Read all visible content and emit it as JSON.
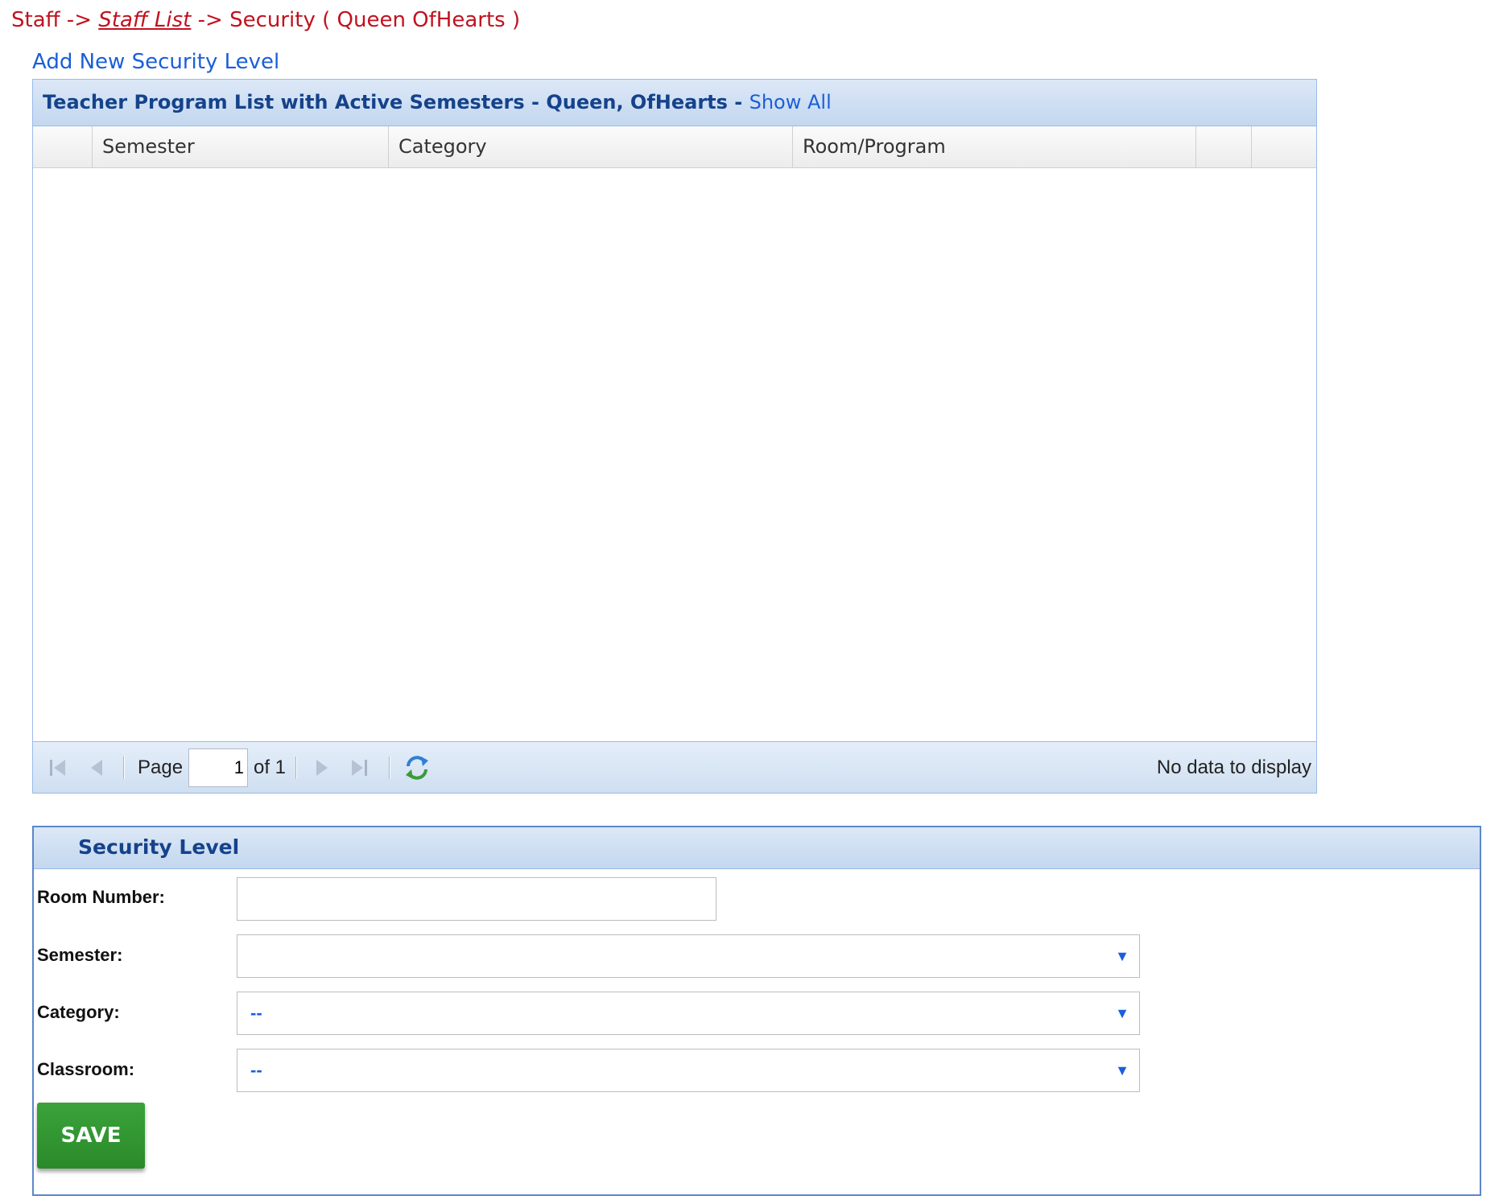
{
  "breadcrumb": {
    "root": "Staff",
    "sep1": " -> ",
    "link": "Staff List",
    "sep2": " -> ",
    "current": "Security ( Queen OfHearts )"
  },
  "add_link": "Add New Security Level",
  "grid": {
    "title": "Teacher Program List with Active Semesters - Queen, OfHearts - ",
    "show_all": "Show All",
    "columns": [
      "",
      "Semester",
      "Category",
      "Room/Program",
      "",
      ""
    ],
    "toolbar": {
      "page_label": "Page",
      "page_value": "1",
      "page_of": "of 1",
      "status": "No data to display"
    }
  },
  "security": {
    "title": "Security Level",
    "room_label": "Room Number:",
    "room_value": "",
    "semester_label": "Semester:",
    "semester_value": "",
    "category_label": "Category:",
    "category_value": "--",
    "classroom_label": "Classroom:",
    "classroom_value": "--",
    "dropdown_arrow": "▼",
    "save_label": "SAVE"
  },
  "colors": {
    "breadcrumb": "#c1121f",
    "link_blue": "#1a5fd8",
    "panel_title": "#15428b",
    "save_green": "#2e9a2e"
  }
}
